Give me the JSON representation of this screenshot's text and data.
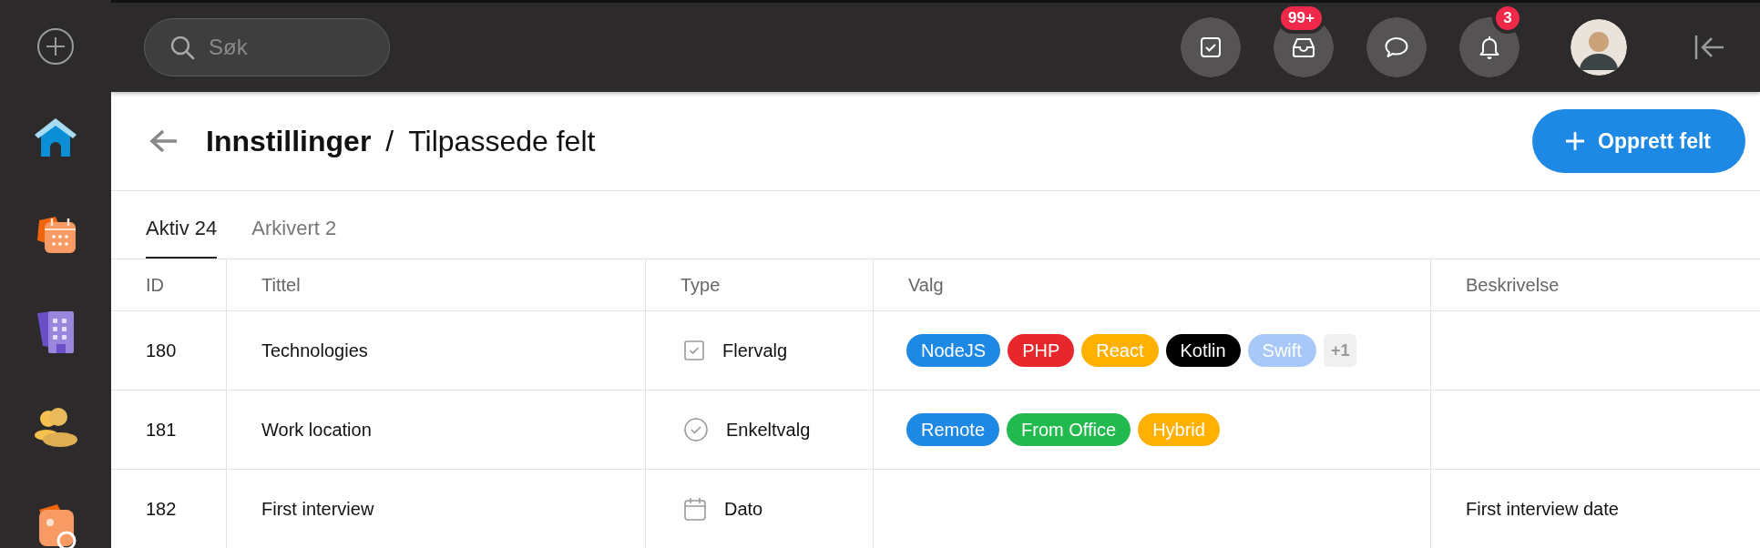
{
  "sidebar": {
    "items": [
      {
        "kind": "add"
      },
      {
        "kind": "home"
      },
      {
        "kind": "calendar"
      },
      {
        "kind": "building"
      },
      {
        "kind": "people"
      },
      {
        "kind": "contact"
      }
    ]
  },
  "top_bar": {
    "search": {
      "placeholder": "Søk"
    },
    "buttons": [
      {
        "kind": "tasks"
      },
      {
        "kind": "inbox",
        "badge": "99+"
      },
      {
        "kind": "chat"
      },
      {
        "kind": "notifications",
        "badge": "3"
      }
    ]
  },
  "header": {
    "breadcrumb": [
      "Innstillinger",
      "Tilpassede felt"
    ],
    "separator": "/",
    "create_button": "Opprett felt"
  },
  "tabs": [
    {
      "label": "Aktiv 24",
      "selected": true
    },
    {
      "label": "Arkivert 2",
      "selected": false
    }
  ],
  "table": {
    "columns": [
      "ID",
      "Tittel",
      "Type",
      "Valg",
      "Beskrivelse"
    ],
    "rows": [
      {
        "id": "180",
        "title": "Technologies",
        "kind": "multi",
        "type": "Flervalg",
        "options": [
          {
            "label": "NodeJS",
            "color": "#1e88e5"
          },
          {
            "label": "PHP",
            "color": "#e8272d"
          },
          {
            "label": "React",
            "color": "#ffb000"
          },
          {
            "label": "Kotlin",
            "color": "#000000"
          },
          {
            "label": "Swift",
            "color": "#a8c8f8"
          }
        ],
        "more": "+1",
        "description": ""
      },
      {
        "id": "181",
        "title": "Work location",
        "kind": "single",
        "type": "Enkeltvalg",
        "options": [
          {
            "label": "Remote",
            "color": "#1e88e5"
          },
          {
            "label": "From Office",
            "color": "#22b94f"
          },
          {
            "label": "Hybrid",
            "color": "#ffb000"
          }
        ],
        "description": ""
      },
      {
        "id": "182",
        "title": "First interview",
        "kind": "date",
        "type": "Dato",
        "options": [],
        "description": "First interview date"
      }
    ]
  }
}
